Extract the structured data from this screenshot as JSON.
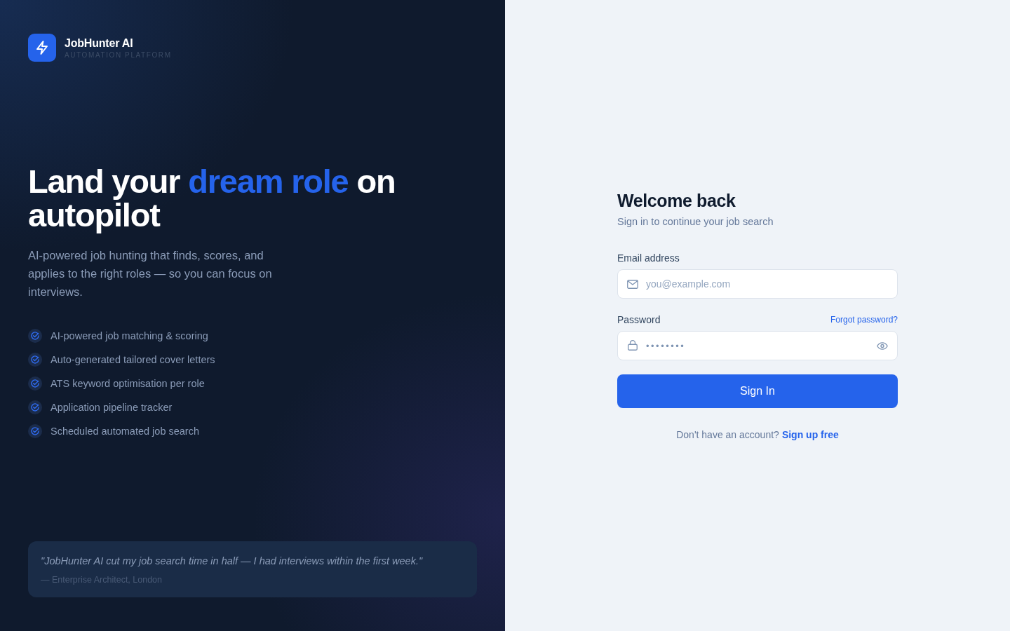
{
  "brand": {
    "name": "JobHunter AI",
    "tagline": "AUTOMATION PLATFORM"
  },
  "hero": {
    "headline": [
      {
        "text": "Land your ",
        "highlight": false
      },
      {
        "text": "dream role",
        "highlight": true
      },
      {
        "text": " on autopilot",
        "highlight": false
      }
    ],
    "description": "AI-powered job hunting that finds, scores, and applies to the right roles — so you can focus on interviews."
  },
  "features": [
    "AI-powered job matching & scoring",
    "Auto-generated tailored cover letters",
    "ATS keyword optimisation per role",
    "Application pipeline tracker",
    "Scheduled automated job search"
  ],
  "testimonial": {
    "quote": "\"JobHunter AI cut my job search time in half — I had interviews within the first week.\"",
    "attribution": "— Enterprise Architect, London"
  },
  "login": {
    "title": "Welcome back",
    "subtitle": "Sign in to continue your job search",
    "fields": [
      {
        "kind": "email",
        "label": "Email address",
        "placeholder": "you@example.com"
      },
      {
        "kind": "password",
        "label": "Password",
        "value": "••••••••",
        "link": "Forgot password?"
      }
    ],
    "submit": "Sign In",
    "signup": {
      "prompt": "Don't have an account?",
      "link": "Sign up free"
    }
  }
}
